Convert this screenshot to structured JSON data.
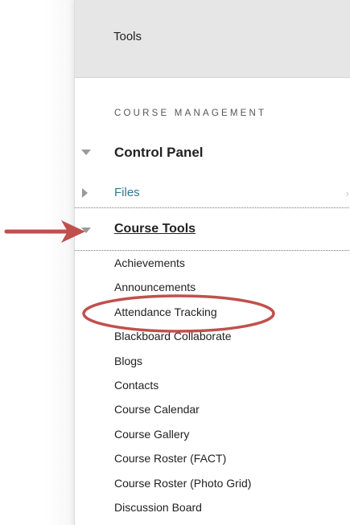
{
  "header": {
    "tools_label": "Tools"
  },
  "course_management": {
    "heading": "COURSE MANAGEMENT",
    "control_panel_label": "Control Panel",
    "files_label": "Files",
    "course_tools_label": "Course Tools",
    "course_tools_items": [
      "Achievements",
      "Announcements",
      "Attendance Tracking",
      "Blackboard Collaborate",
      "Blogs",
      "Contacts",
      "Course Calendar",
      "Course Gallery",
      "Course Roster (FACT)",
      "Course Roster (Photo Grid)",
      "Discussion Board"
    ]
  },
  "annotations": {
    "arrow_color": "#c0504d",
    "highlight_color": "#c0504d",
    "highlighted_item": "Attendance Tracking"
  },
  "icons": {
    "expanded": "triangle-down-icon",
    "collapsed": "triangle-right-icon",
    "files_flyout": "chevron-right-icon"
  }
}
